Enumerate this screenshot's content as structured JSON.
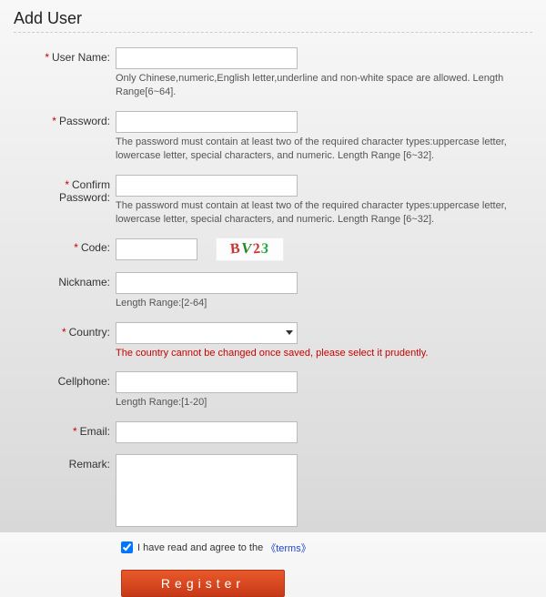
{
  "pageTitle": "Add User",
  "fields": {
    "username": {
      "label": "User Name:",
      "hint": "Only Chinese,numeric,English letter,underline and non-white space are allowed. Length Range[6~64]."
    },
    "password": {
      "label": "Password:",
      "hint": "The password must contain at least two of the required character types:uppercase letter, lowercase letter, special characters, and numeric. Length Range [6~32]."
    },
    "confirmPassword": {
      "label": "Confirm Password:",
      "hint": "The password must contain at least two of the required character types:uppercase letter, lowercase letter, special characters, and numeric. Length Range [6~32]."
    },
    "code": {
      "label": "Code:",
      "captchaText": "BV23"
    },
    "nickname": {
      "label": "Nickname:",
      "hint": "Length Range:[2-64]"
    },
    "country": {
      "label": "Country:",
      "hint": "The country cannot be changed once saved, please select it prudently."
    },
    "cellphone": {
      "label": "Cellphone:",
      "hint": "Length Range:[1-20]"
    },
    "email": {
      "label": "Email:"
    },
    "remark": {
      "label": "Remark:"
    }
  },
  "terms": {
    "text": "I have read and agree to the",
    "linkText": "《terms》",
    "checked": true
  },
  "registerButton": "Register"
}
